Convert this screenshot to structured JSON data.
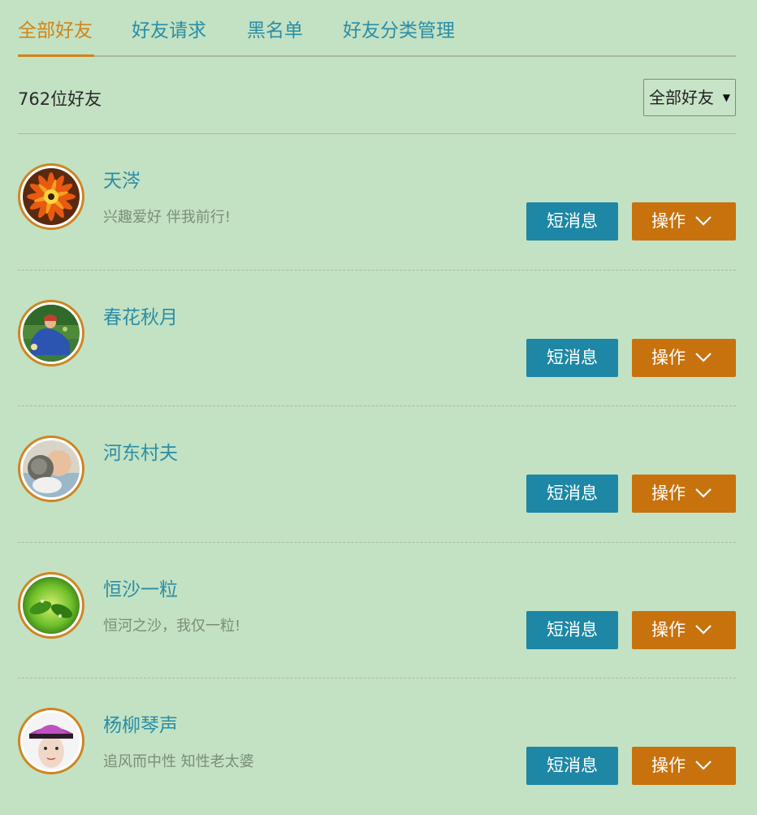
{
  "tabs": [
    {
      "label": "全部好友",
      "active": true
    },
    {
      "label": "好友请求",
      "active": false
    },
    {
      "label": "黑名单",
      "active": false
    },
    {
      "label": "好友分类管理",
      "active": false
    }
  ],
  "friend_count": "762位好友",
  "filter": {
    "selected": "全部好友"
  },
  "buttons": {
    "message": "短消息",
    "operate": "操作"
  },
  "friends": [
    {
      "name": "天涔",
      "signature": "兴趣爱好 伴我前行!"
    },
    {
      "name": "春花秋月",
      "signature": ""
    },
    {
      "name": "河东村夫",
      "signature": ""
    },
    {
      "name": "恒沙一粒",
      "signature": "恒河之沙，我仅一粒!"
    },
    {
      "name": "杨柳琴声",
      "signature": "追风而中性 知性老太婆"
    }
  ],
  "colors": {
    "background": "#c3e2c3",
    "tab_active": "#d08417",
    "link": "#2a8da6",
    "message_button": "#1e87a5",
    "operate_button": "#c8720e",
    "avatar_ring": "#cf8522"
  },
  "icons": {
    "operate_dropdown": "chevron-down-icon",
    "select_caret": "caret-down-icon"
  }
}
